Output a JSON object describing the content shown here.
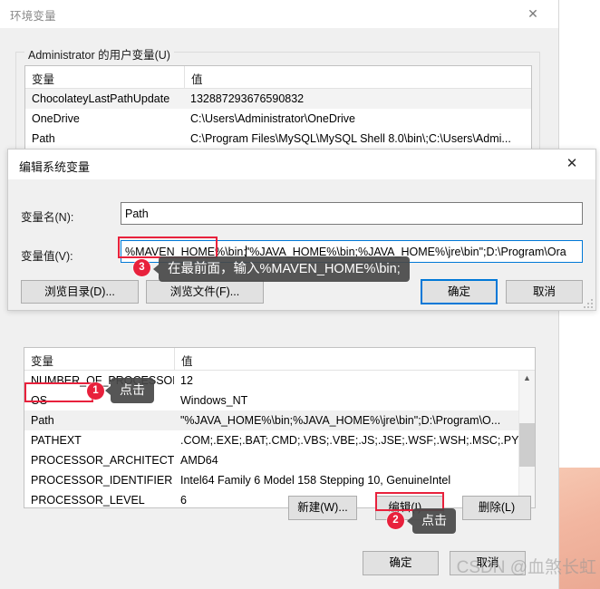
{
  "env_window": {
    "title": "环境变量",
    "close_icon": "close-icon",
    "user_group_title": "Administrator 的用户变量(U)",
    "user_table": {
      "columns": [
        "变量",
        "值"
      ],
      "rows": [
        {
          "name": "ChocolateyLastPathUpdate",
          "value": "132887293676590832"
        },
        {
          "name": "OneDrive",
          "value": "C:\\Users\\Administrator\\OneDrive"
        },
        {
          "name": "Path",
          "value": "C:\\Program Files\\MySQL\\MySQL Shell 8.0\\bin\\;C:\\Users\\Admi..."
        }
      ]
    },
    "system_table": {
      "columns": [
        "变量",
        "值"
      ],
      "rows": [
        {
          "name": "NUMBER_OF_PROCESSORS",
          "value": "12"
        },
        {
          "name": "OS",
          "value": "Windows_NT"
        },
        {
          "name": "Path",
          "value": "\"%JAVA_HOME%\\bin;%JAVA_HOME%\\jre\\bin\";D:\\Program\\O..."
        },
        {
          "name": "PATHEXT",
          "value": ".COM;.EXE;.BAT;.CMD;.VBS;.VBE;.JS;.JSE;.WSF;.WSH;.MSC;.PY;.P..."
        },
        {
          "name": "PROCESSOR_ARCHITECT...",
          "value": "AMD64"
        },
        {
          "name": "PROCESSOR_IDENTIFIER",
          "value": "Intel64 Family 6 Model 158 Stepping 10, GenuineIntel"
        },
        {
          "name": "PROCESSOR_LEVEL",
          "value": "6"
        }
      ]
    },
    "system_buttons": {
      "new": "新建(W)...",
      "edit": "编辑(I)...",
      "delete": "删除(L)"
    },
    "footer_buttons": {
      "ok": "确定",
      "cancel": "取消"
    },
    "scroll": {
      "up_icon": "chevron-up-icon",
      "down_icon": "chevron-down-icon"
    }
  },
  "edit_dialog": {
    "title": "编辑系统变量",
    "close_icon": "close-icon",
    "name_label": "变量名(N):",
    "name_value": "Path",
    "value_label": "变量值(V):",
    "value_prefix": "%MAVEN_HOME%\\bin;",
    "value_rest": "\"%JAVA_HOME%\\bin;%JAVA_HOME%\\jre\\bin\";D:\\Program\\Ora",
    "browse_dir": "浏览目录(D)...",
    "browse_file": "浏览文件(F)...",
    "ok": "确定",
    "cancel": "取消"
  },
  "annotations": {
    "step1_badge": "1",
    "step1_tip": "点击",
    "step2_badge": "2",
    "step2_tip": "点击",
    "step3_badge": "3",
    "step3_tip": "在最前面，输入%MAVEN_HOME%\\bin;"
  },
  "watermark": "CSDN @血煞长虹",
  "colors": {
    "accent": "#0078d7",
    "annotation_red": "#e8213c",
    "window_bg": "#f0f0f0",
    "tooltip_bg": "#484848"
  }
}
